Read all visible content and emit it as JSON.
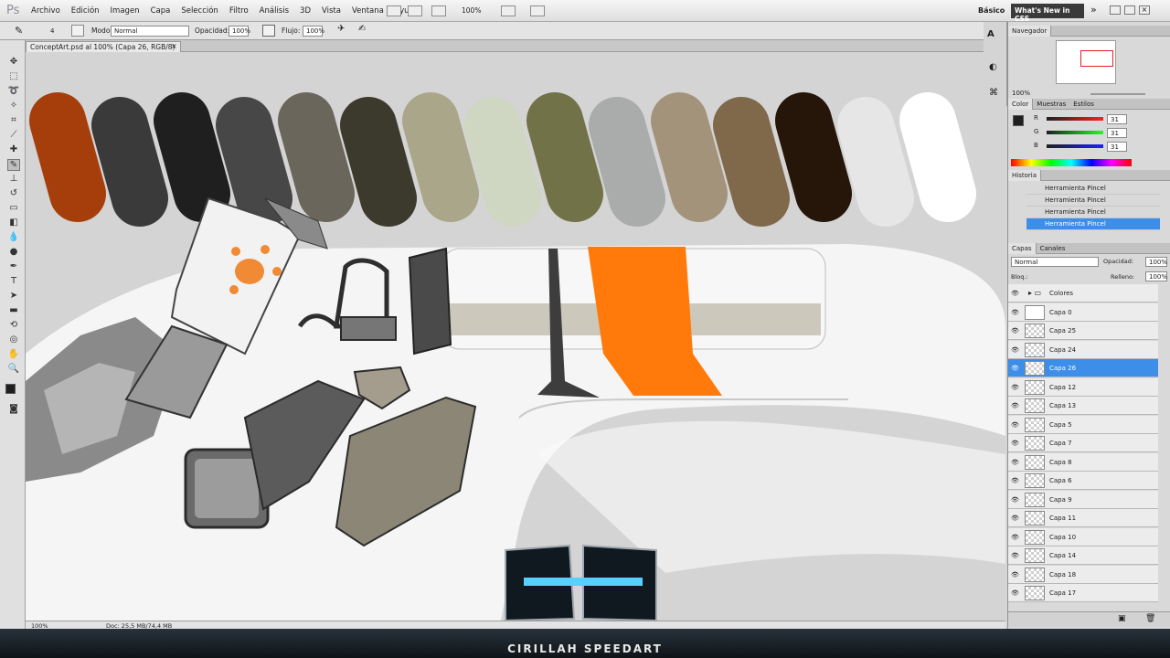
{
  "app": {
    "logo": "Ps",
    "workspace": "Básico",
    "workspace_alt": "What's New in CSS"
  },
  "menus": [
    "Archivo",
    "Edición",
    "Imagen",
    "Capa",
    "Selección",
    "Filtro",
    "Análisis",
    "3D",
    "Vista",
    "Ventana",
    "Ayuda"
  ],
  "menubar_zoom": "100%",
  "options": {
    "brush_size": "4",
    "mode_label": "Modo:",
    "mode": "Normal",
    "opacity_label": "Opacidad:",
    "opacity": "100%",
    "flow_label": "Flujo:",
    "flow": "100%"
  },
  "document": {
    "tab": "ConceptArt.psd al 100% (Capa 26, RGB/8) *",
    "status_zoom": "100%",
    "status_doc": "Doc: 25,5 MB/74,4 MB"
  },
  "navigator": {
    "title": "Navegador",
    "zoom": "100%"
  },
  "color": {
    "tabs": [
      "Color",
      "Muestras",
      "Estilos"
    ],
    "r_label": "R",
    "g_label": "G",
    "b_label": "B",
    "r": "31",
    "g": "31",
    "b": "31"
  },
  "history": {
    "title": "Historia",
    "items": [
      "Herramienta Pincel",
      "Herramienta Pincel",
      "Herramienta Pincel",
      "Herramienta Pincel"
    ]
  },
  "layers": {
    "tabs": [
      "Capas",
      "Canales"
    ],
    "mode": "Normal",
    "opacity_label": "Opacidad:",
    "opacity": "100%",
    "lock_label": "Bloq.:",
    "fill_label": "Relleno:",
    "fill": "100%",
    "items": [
      "Colores",
      "Capa 0",
      "Capa 25",
      "Capa 24",
      "Capa 26",
      "Capa 12",
      "Capa 13",
      "Capa 5",
      "Capa 7",
      "Capa 8",
      "Capa 6",
      "Capa 9",
      "Capa 11",
      "Capa 10",
      "Capa 14",
      "Capa 18",
      "Capa 17"
    ],
    "selected": "Capa 26"
  },
  "banner": {
    "title": "CIRILLAH SPEEDART"
  },
  "swatch_colors": [
    "#a63e0c",
    "#3a3a3a",
    "#1f1f1f",
    "#474747",
    "#6a665c",
    "#3c3a2c",
    "#aaa68a",
    "#cfd7c3",
    "#717248",
    "#aaabab",
    "#a4937b",
    "#80684b",
    "#261609",
    "#e6e6e6",
    "#ffffff"
  ],
  "accent": "#ff7a0a"
}
